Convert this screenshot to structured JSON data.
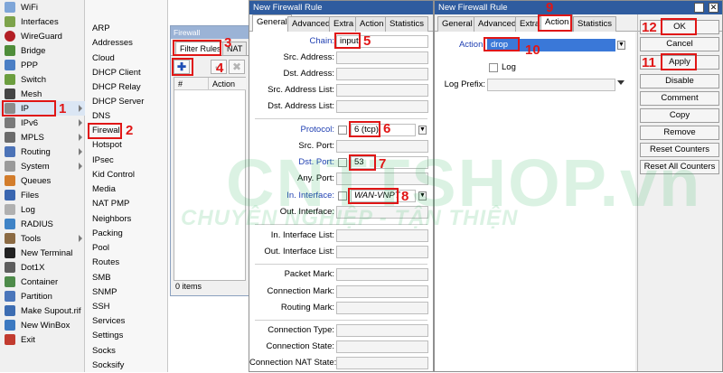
{
  "main_menu": {
    "items": [
      {
        "label": "WiFi",
        "icon": "wifi-icon",
        "color": "#7fa6d8",
        "arrow": false
      },
      {
        "label": "Interfaces",
        "icon": "interfaces-icon",
        "color": "#7da34b",
        "arrow": false
      },
      {
        "label": "WireGuard",
        "icon": "wireguard-icon",
        "color": "#b31f25",
        "arrow": false
      },
      {
        "label": "Bridge",
        "icon": "bridge-icon",
        "color": "#4f8d3a",
        "arrow": false
      },
      {
        "label": "PPP",
        "icon": "ppp-icon",
        "color": "#4b7fc5",
        "arrow": false
      },
      {
        "label": "Switch",
        "icon": "switch-icon",
        "color": "#6c9e3f",
        "arrow": false
      },
      {
        "label": "Mesh",
        "icon": "mesh-icon",
        "color": "#444444",
        "arrow": false
      },
      {
        "label": "IP",
        "icon": "ip-icon",
        "color": "#8c8c8c",
        "arrow": true
      },
      {
        "label": "IPv6",
        "icon": "ipv6-icon",
        "color": "#7a7a7a",
        "arrow": true
      },
      {
        "label": "MPLS",
        "icon": "mpls-icon",
        "color": "#6b6b6b",
        "arrow": true
      },
      {
        "label": "Routing",
        "icon": "routing-icon",
        "color": "#4c73b7",
        "arrow": true
      },
      {
        "label": "System",
        "icon": "system-icon",
        "color": "#9a9a9a",
        "arrow": true
      },
      {
        "label": "Queues",
        "icon": "queues-icon",
        "color": "#d37d2c",
        "arrow": false
      },
      {
        "label": "Files",
        "icon": "files-icon",
        "color": "#3a66b0",
        "arrow": false
      },
      {
        "label": "Log",
        "icon": "log-icon",
        "color": "#b0b0b0",
        "arrow": false
      },
      {
        "label": "RADIUS",
        "icon": "radius-icon",
        "color": "#3f83c6",
        "arrow": false
      },
      {
        "label": "Tools",
        "icon": "tools-icon",
        "color": "#8b6a43",
        "arrow": true
      },
      {
        "label": "New Terminal",
        "icon": "terminal-icon",
        "color": "#222222",
        "arrow": false
      },
      {
        "label": "Dot1X",
        "icon": "dot1x-icon",
        "color": "#5e5e5e",
        "arrow": false
      },
      {
        "label": "Container",
        "icon": "container-icon",
        "color": "#4e8b4a",
        "arrow": false
      },
      {
        "label": "Partition",
        "icon": "partition-icon",
        "color": "#4a76bb",
        "arrow": false
      },
      {
        "label": "Make Supout.rif",
        "icon": "supout-icon",
        "color": "#3d6db2",
        "arrow": false
      },
      {
        "label": "New WinBox",
        "icon": "winbox-icon",
        "color": "#3c79c1",
        "arrow": false
      },
      {
        "label": "Exit",
        "icon": "exit-icon",
        "color": "#c23b2f",
        "arrow": false
      }
    ]
  },
  "ip_submenu": {
    "items": [
      "ARP",
      "Addresses",
      "Cloud",
      "DHCP Client",
      "DHCP Relay",
      "DHCP Server",
      "DNS",
      "Firewall",
      "Hotspot",
      "IPsec",
      "Kid Control",
      "Media",
      "NAT PMP",
      "Neighbors",
      "Packing",
      "Pool",
      "Routes",
      "SMB",
      "SNMP",
      "SSH",
      "Services",
      "Settings",
      "Socks",
      "Socksify"
    ]
  },
  "firewall_window": {
    "title": "Firewall",
    "tabs": [
      "Filter Rules",
      "NAT"
    ],
    "columns": [
      "#",
      "Action"
    ],
    "status": "0 items",
    "add_icon": "plus-icon"
  },
  "rule_dialog_general": {
    "title": "New Firewall Rule",
    "tabs": [
      "General",
      "Advanced",
      "Extra",
      "Action",
      "Statistics"
    ],
    "fields": {
      "chain": {
        "label": "Chain:",
        "value": "input"
      },
      "src_address": {
        "label": "Src. Address:"
      },
      "dst_address": {
        "label": "Dst. Address:"
      },
      "src_address_list": {
        "label": "Src. Address List:"
      },
      "dst_address_list": {
        "label": "Dst. Address List:"
      },
      "protocol": {
        "label": "Protocol:",
        "value": "6 (tcp)"
      },
      "src_port": {
        "label": "Src. Port:"
      },
      "dst_port": {
        "label": "Dst. Port:",
        "value": "53"
      },
      "any_port": {
        "label": "Any. Port:"
      },
      "in_interface": {
        "label": "In. Interface:",
        "value": "WAN-VNPT"
      },
      "out_interface": {
        "label": "Out. Interface:"
      },
      "in_interface_list": {
        "label": "In. Interface List:"
      },
      "out_interface_list": {
        "label": "Out. Interface List:"
      },
      "packet_mark": {
        "label": "Packet Mark:"
      },
      "connection_mark": {
        "label": "Connection Mark:"
      },
      "routing_mark": {
        "label": "Routing Mark:"
      },
      "connection_type": {
        "label": "Connection Type:"
      },
      "connection_state": {
        "label": "Connection State:"
      },
      "connection_nat_state": {
        "label": "Connection NAT State:"
      }
    }
  },
  "rule_dialog_action": {
    "title": "New Firewall Rule",
    "tabs": [
      "General",
      "Advanced",
      "Extra",
      "Action",
      "Statistics"
    ],
    "action_label": "Action:",
    "action_value": "drop",
    "log_label": "Log",
    "log_prefix_label": "Log Prefix:"
  },
  "side_buttons": [
    "OK",
    "Cancel",
    "Apply",
    "Disable",
    "Comment",
    "Copy",
    "Remove",
    "Reset Counters",
    "Reset All Counters"
  ],
  "annotations": [
    "1",
    "2",
    "3",
    "4",
    "5",
    "6",
    "7",
    "8",
    "9",
    "10",
    "11",
    "12"
  ],
  "watermark": {
    "line1": "CNTTSHOP.vn",
    "line2": "CHUYÊN NGHIỆP - TẬN THIỆN"
  },
  "colors": {
    "annotation_red": "#e01616",
    "title_blue": "#2f5c9f",
    "selection_blue": "#3a78d8",
    "label_blue": "#1f3fb2",
    "watermark_green": "#29b45a"
  }
}
